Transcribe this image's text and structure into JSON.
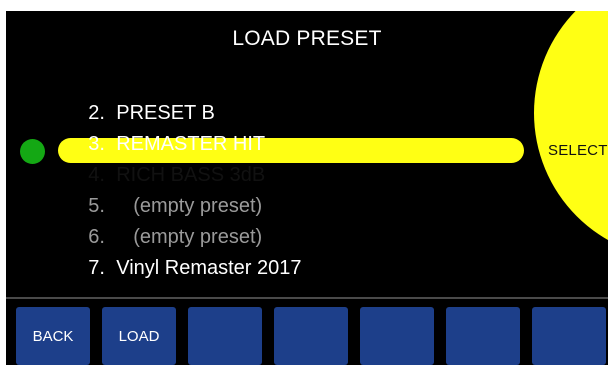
{
  "screen": {
    "title": "LOAD PRESET",
    "select_label": "SELECT"
  },
  "presets": [
    {
      "number": "2.",
      "name": "PRESET B",
      "state": "normal"
    },
    {
      "number": "3.",
      "name": "REMASTER HIT",
      "state": "normal"
    },
    {
      "number": "4.",
      "name": "RICH BASS 3dB",
      "state": "selected"
    },
    {
      "number": "5.",
      "name": "(empty preset)",
      "state": "empty"
    },
    {
      "number": "6.",
      "name": "(empty preset)",
      "state": "empty"
    },
    {
      "number": "7.",
      "name": "Vinyl Remaster 2017",
      "state": "normal"
    }
  ],
  "softkeys": [
    {
      "label": "BACK"
    },
    {
      "label": "LOAD"
    },
    {
      "label": ""
    },
    {
      "label": ""
    },
    {
      "label": ""
    },
    {
      "label": ""
    },
    {
      "label": ""
    }
  ],
  "colors": {
    "background": "#000000",
    "highlight": "#ffff14",
    "active_indicator": "#14a814",
    "softkey": "#1d3f8a",
    "empty_text": "#9a9a9a"
  }
}
